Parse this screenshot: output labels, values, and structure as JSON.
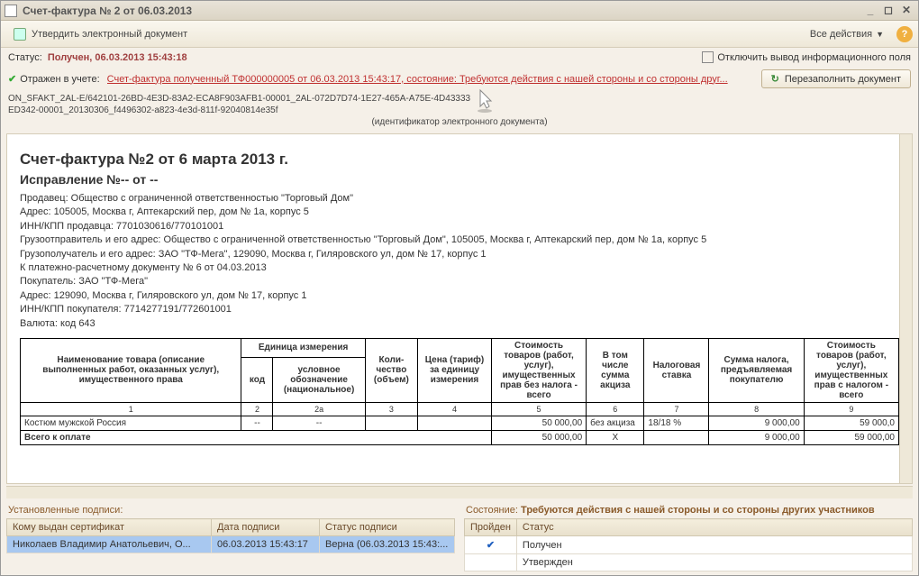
{
  "window": {
    "title": "Счет-фактура № 2 от 06.03.2013"
  },
  "toolbar": {
    "approve": "Утвердить электронный документ",
    "all_actions": "Все действия"
  },
  "status": {
    "label": "Статус:",
    "value": "Получен, 06.03.2013 15:43:18",
    "disable_info": "Отключить вывод информационного поля"
  },
  "reflect": {
    "label": "Отражен в учете:",
    "link": "Счет-фактура полученный ТФ000000005 от 06.03.2013 15:43:17, состояние: Требуются действия с нашей стороны и со стороны друг...",
    "refill": "Перезаполнить документ"
  },
  "doc_id": {
    "line1": "ON_SFAKT_2AL-E/642101-26BD-4E3D-83A2-ECA8F903AFB1-00001_2AL-072D7D74-1E27-465A-A75E-4D43333",
    "line2": "ED342-00001_20130306_f4496302-a823-4e3d-811f-92040814e35f",
    "sub": "(идентификатор электронного документа)"
  },
  "doc": {
    "title": "Счет-фактура №2 от 6 марта 2013 г.",
    "correction": "Исправление №-- от --",
    "seller": "Продавец: Общество с ограниченной ответственностью \"Торговый Дом\"",
    "seller_addr": "Адрес: 105005, Москва г, Аптекарский пер, дом № 1а, корпус 5",
    "seller_inn": "ИНН/КПП продавца: 7701030616/770101001",
    "shipper": "Грузоотправитель и его адрес: Общество с ограниченной ответственностью \"Торговый Дом\", 105005, Москва г, Аптекарский пер, дом № 1а, корпус 5",
    "consignee": "Грузополучатель и его адрес: ЗАО \"ТФ-Мега\", 129090, Москва г, Гиляровского ул, дом № 17, корпус 1",
    "payment": "К платежно-расчетному документу № 6 от 04.03.2013",
    "buyer": "Покупатель: ЗАО \"ТФ-Мега\"",
    "buyer_addr": "Адрес: 129090, Москва г, Гиляровского ул, дом № 17, корпус 1",
    "buyer_inn": "ИНН/КПП покупателя: 7714277191/772601001",
    "currency": "Валюта: код 643"
  },
  "table": {
    "headers": {
      "name": "Наименование товара (описание выполненных работ, оказанных услуг), имущественного права",
      "unit": "Единица измерения",
      "code": "код",
      "unit_name": "условное обозначение (национальное)",
      "qty": "Коли-чество (объем)",
      "price": "Цена (тариф) за единицу измерения",
      "cost_notax": "Стоимость товаров (работ, услуг), имущественных прав без налога - всего",
      "excise": "В том числе сумма акциза",
      "rate": "Налоговая ставка",
      "tax_sum": "Сумма налога, предъявляемая покупателю",
      "cost_tax": "Стоимость товаров (работ, услуг), имущественных прав с налогом - всего"
    },
    "nums": [
      "1",
      "2",
      "2а",
      "3",
      "4",
      "5",
      "6",
      "7",
      "8",
      "9"
    ],
    "rows": [
      {
        "name": "Костюм мужской Россия",
        "code": "--",
        "unit_name": "--",
        "qty": "",
        "price": "",
        "cost_notax": "50 000,00",
        "excise": "без акциза",
        "rate": "18/18 %",
        "tax_sum": "9 000,00",
        "cost_tax": "59 000,0"
      }
    ],
    "total": {
      "label": "Всего к оплате",
      "cost_notax": "50 000,00",
      "excise": "X",
      "tax_sum": "9 000,00",
      "cost_tax": "59 000,00"
    }
  },
  "signatures": {
    "label": "Установленные подписи:",
    "cols": {
      "cert": "Кому выдан сертификат",
      "date": "Дата подписи",
      "status": "Статус подписи"
    },
    "rows": [
      {
        "cert": "Николаев Владимир Анатольевич, О...",
        "date": "06.03.2013 15:43:17",
        "status": "Верна (06.03.2013 15:43:..."
      }
    ]
  },
  "state": {
    "label": "Состояние:",
    "value": "Требуются действия с нашей стороны и со стороны других участников",
    "cols": {
      "passed": "Пройден",
      "status": "Статус"
    },
    "rows": [
      {
        "passed": "✔",
        "status": "Получен"
      },
      {
        "passed": "",
        "status": "Утвержден"
      }
    ]
  }
}
